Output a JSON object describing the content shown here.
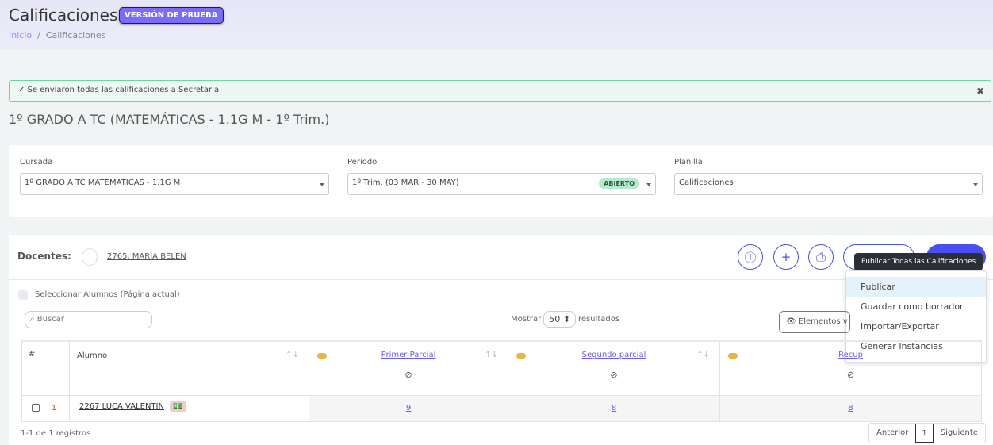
{
  "header": {
    "title": "Calificaciones",
    "badge": "VERSIÓN DE PRUEBA",
    "breadcrumb": [
      "Inicio",
      "Calificaciones"
    ]
  },
  "alert": {
    "message": "✓ Se enviaron todas las calificaciones a Secretaria",
    "close": "✖"
  },
  "subtitle": "1º GRADO A TC (MATEMÁTICAS - 1.1G M - 1º Trim.)",
  "filters": {
    "cursada": {
      "label": "Cursada",
      "value": "1º GRADO A TC MATEMATICAS - 1.1G M"
    },
    "periodo": {
      "label": "Periodo",
      "value": "1º Trim. (03 MAR - 30 MAY)",
      "status": "ABIERTO"
    },
    "planilla": {
      "label": "Planilla",
      "value": "Calificaciones"
    }
  },
  "docentes": {
    "label": "Docentes:",
    "name": "2765, MARIA BELEN"
  },
  "tooltip": "Publicar Todas las Calificaciones",
  "menu": [
    "Publicar",
    "Guardar como borrador",
    "Importar/Exportar",
    "Generar Instancias"
  ],
  "select_all": "Seleccionar Alumnos (Página actual)",
  "search": {
    "placeholder": "Buscar"
  },
  "show": {
    "prefix": "Mostrar",
    "value": "50",
    "suffix": "resultados"
  },
  "visible_elements": "Elementos v",
  "table": {
    "headers": [
      "#",
      "Alumno",
      "Primer Parcial",
      "Segundo parcial",
      "Recup"
    ],
    "rows": [
      {
        "n": "1",
        "alumno": "2267 LUCA VALENTIN",
        "grades": [
          "9",
          "8",
          "8"
        ]
      }
    ]
  },
  "footer": {
    "count": "1-1 de 1 registros",
    "prev": "Anterior",
    "page": "1",
    "next": "Siguiente"
  }
}
